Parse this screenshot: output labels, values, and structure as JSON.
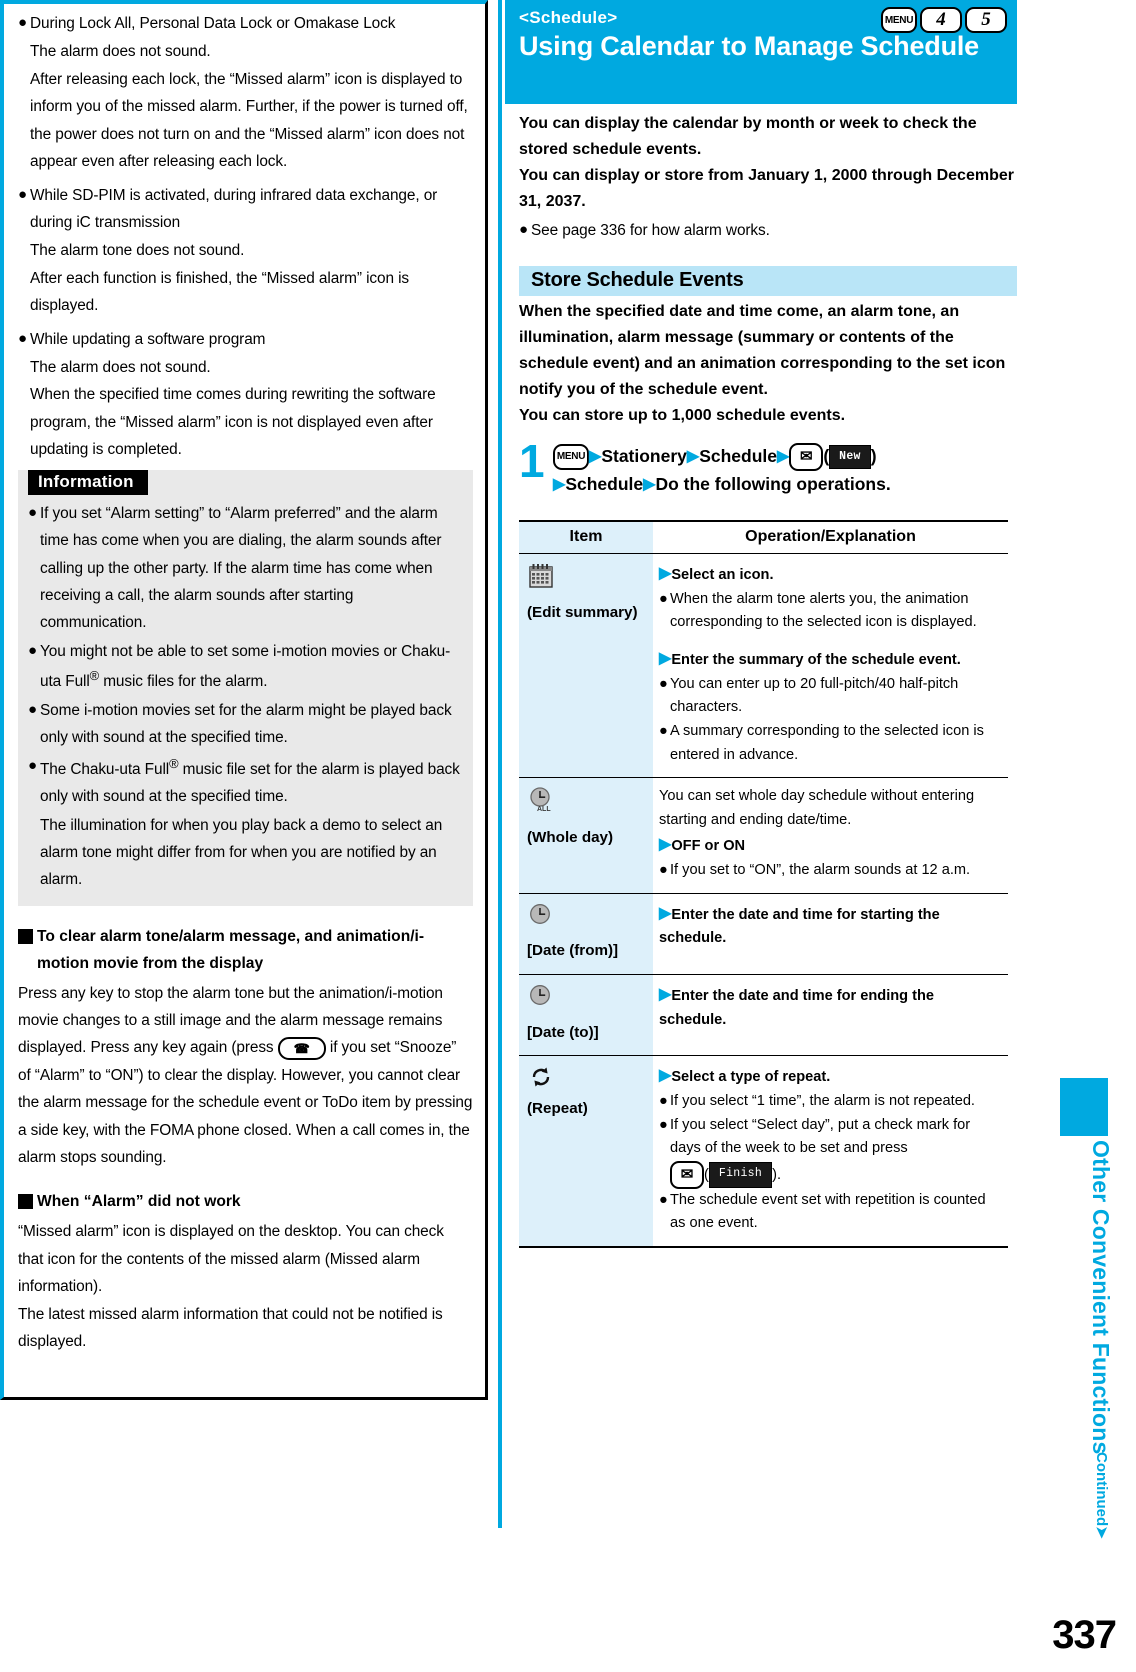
{
  "left_column": {
    "notes": [
      {
        "bullet": "During Lock All, Personal Data Lock or Omakase Lock",
        "lines": [
          "The alarm does not sound.",
          "After releasing each lock, the “Missed alarm” icon is displayed to inform you of the missed alarm. Further, if the power is turned off, the power does not turn on and the “Missed alarm” icon does not appear even after releasing each lock."
        ]
      },
      {
        "bullet": "While SD-PIM is activated, during infrared data exchange, or during iC transmission",
        "lines": [
          "The alarm tone does not sound.",
          "After each function is finished, the “Missed alarm” icon is displayed."
        ]
      },
      {
        "bullet": "While updating a software program",
        "lines": [
          "The alarm does not sound.",
          "When the specified time comes during rewriting the software program, the “Missed alarm” icon is not displayed even after updating is completed."
        ]
      }
    ],
    "information": {
      "tag": "Information",
      "items": [
        "If you set “Alarm setting” to “Alarm preferred” and the alarm time has come when you are dialing, the alarm sounds after calling up the other party. If the alarm time has come when receiving a call, the alarm sounds after starting communication.",
        "You might not be able to set some i-motion movies or Chaku-uta Full® music files for the alarm.",
        "Some i-motion movies set for the alarm might be played back only with sound at the specified time.",
        "The Chaku-uta Full® music file set for the alarm is played back only with sound at the specified time."
      ],
      "trailing_line": "The illumination for when you play back a demo to select an alarm tone might differ from for when you are notified by an alarm."
    },
    "subheads": [
      {
        "title": "To clear alarm tone/alarm message, and animation/i-motion movie from the display",
        "body_a": "Press any key to stop the alarm tone but the animation/i-motion movie changes to a still image and the alarm message remains displayed. Press any key again (press",
        "key_icon": "telephone-key-icon",
        "body_b": "if you set “Snooze” of “Alarm” to “ON”) to clear the display. However, you cannot clear the alarm message for the schedule event or ToDo item by pressing a side key, with the FOMA phone closed. When a call comes in, the alarm stops sounding."
      },
      {
        "title": "When “Alarm” did not work",
        "body": "“Missed alarm” icon is displayed on the desktop. You can check that icon for the contents of the missed alarm (Missed alarm information).\nThe latest missed alarm information that could not be notified is displayed."
      }
    ]
  },
  "right_column": {
    "banner": {
      "subtitle": "<Schedule>",
      "title": "Using Calendar to Manage Schedule",
      "keys": [
        "MENU",
        "4",
        "5"
      ],
      "bg_color": "#00A9E0"
    },
    "lead": [
      "You can display the calendar by month or week to check the stored schedule events.",
      "You can display or store from January 1, 2000 through December 31, 2037."
    ],
    "lead_bullet": "See page 336 for how alarm works.",
    "section": {
      "heading": "Store Schedule Events",
      "heading_bg": "#b9e5f7",
      "intro": "When the specified date and time come, an alarm tone, an illumination, alarm message (summary or contents of the schedule event) and an animation corresponding to the set icon notify you of the schedule event.\nYou can store up to 1,000 schedule events."
    },
    "step": {
      "number": "1",
      "key_menu": "MENU",
      "part1": "Stationery",
      "part2": "Schedule",
      "key_mail": "mail-key-icon",
      "softkey": "New",
      "part3": "Schedule",
      "part4": "Do the following operations."
    },
    "table": {
      "headers": [
        "Item",
        "Operation/Explanation"
      ],
      "rows": [
        {
          "icon": "calendar-icon",
          "item": "(Edit summary)",
          "ops": [
            {
              "type": "head",
              "text": "Select an icon."
            },
            {
              "type": "bullet",
              "text": "When the alarm tone alerts you, the animation corresponding to the selected icon is displayed."
            },
            {
              "type": "gap"
            },
            {
              "type": "head",
              "text": "Enter the summary of the schedule event."
            },
            {
              "type": "bullet",
              "text": "You can enter up to 20 full-pitch/40 half-pitch characters."
            },
            {
              "type": "bullet",
              "text": "A summary corresponding to the selected icon is entered in advance."
            }
          ]
        },
        {
          "icon": "clock-all-icon",
          "item": "(Whole day)",
          "ops": [
            {
              "type": "plain",
              "text": "You can set whole day schedule without entering starting and ending date/time."
            },
            {
              "type": "head",
              "text": "OFF or ON"
            },
            {
              "type": "bullet",
              "text": "If you set to “ON”, the alarm sounds at 12 a.m."
            }
          ]
        },
        {
          "icon": "clock-icon",
          "item": "[Date (from)]",
          "ops": [
            {
              "type": "head",
              "text": "Enter the date and time for starting the schedule."
            }
          ]
        },
        {
          "icon": "clock-icon",
          "item": "[Date (to)]",
          "ops": [
            {
              "type": "head",
              "text": "Enter the date and time for ending the schedule."
            }
          ]
        },
        {
          "icon": "repeat-icon",
          "item": "(Repeat)",
          "ops": [
            {
              "type": "head",
              "text": "Select a type of repeat."
            },
            {
              "type": "bullet",
              "text": "If you select “1 time”, the alarm is not repeated."
            },
            {
              "type": "bullet-key",
              "text_a": "If you select “Select day”, put a check mark for days of the week to be set and press",
              "softkey": "Finish",
              "text_b": ")."
            },
            {
              "type": "bullet",
              "text": "The schedule event set with repetition is counted as one event."
            }
          ]
        }
      ]
    }
  },
  "margin": {
    "chapter": "Other Convenient Functions",
    "continued": "Continued",
    "page_number": "337",
    "accent_color": "#00A9E0"
  }
}
